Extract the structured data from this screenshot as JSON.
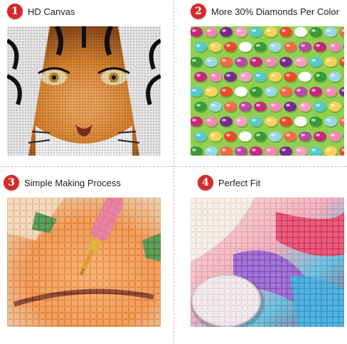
{
  "features": [
    {
      "number": "1",
      "label": "HD Canvas",
      "image": "tiger-face-diamond-painting"
    },
    {
      "number": "2",
      "label": "More 30% Diamonds Per Color",
      "image": "rows-of-colored-diamond-drills"
    },
    {
      "number": "3",
      "label": "Simple Making Process",
      "image": "pen-placing-drill-on-canvas"
    },
    {
      "number": "4",
      "label": "Perfect Fit",
      "image": "canvas-corner-close-up"
    }
  ],
  "colors": {
    "badge": "#d32b2b",
    "divider": "#d9b3b3"
  }
}
